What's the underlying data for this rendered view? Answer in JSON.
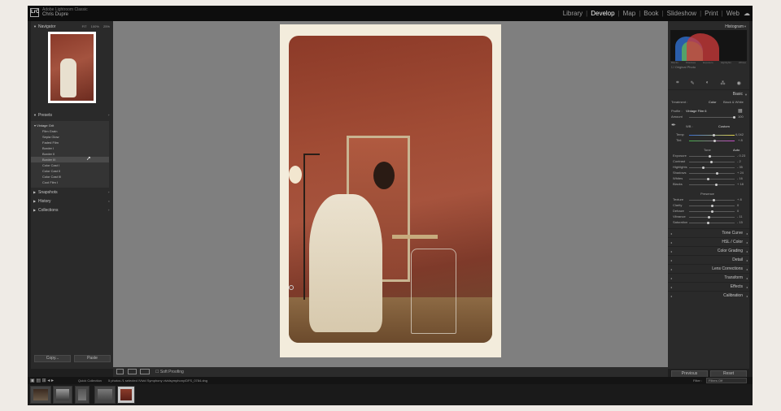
{
  "catalog": {
    "line1": "Adobe Lightroom Classic",
    "user": "Chris Dupre"
  },
  "modules": [
    "Library",
    "Develop",
    "Map",
    "Book",
    "Slideshow",
    "Print",
    "Web"
  ],
  "active_module": "Develop",
  "left_panel": {
    "navigator": {
      "title": "Navigator",
      "options": [
        "FIT",
        "100%",
        "25%"
      ]
    },
    "presets": {
      "title": "Presets",
      "group": "Vintage Grit",
      "items": [
        "Film Grain",
        "Sepia Glow",
        "Faded Film",
        "Border I",
        "Border II",
        "Border III",
        "Color Cast I",
        "Color Cast II",
        "Color Cast III",
        "Cool Film I"
      ]
    },
    "snapshots": "Snapshots",
    "history": "History",
    "collections": "Collections",
    "copy_button": "Copy...",
    "paste_button": "Paste"
  },
  "toolbar": {
    "soft_proofing": "Soft Proofing"
  },
  "right_panel": {
    "histogram_title": "Histogram",
    "histogram_labels": [
      "Blacks",
      "Shadows",
      "Exposure",
      "Highlights",
      "Whites"
    ],
    "original_photo": "Original Photo",
    "basic": {
      "title": "Basic",
      "treatment_label": "Treatment :",
      "treatment_color": "Color",
      "treatment_bw": "Black & White",
      "profile_label": "Profile :",
      "profile_value": "Vintage Film 6",
      "amount_label": "Amount",
      "amount_value": "100",
      "wb_label": "WB :",
      "wb_value": "Custom",
      "temp_label": "Temp",
      "temp_value": "6,042",
      "tint_label": "Tint",
      "tint_value": "+ 8",
      "tone_label": "Tone",
      "tone_auto": "Auto",
      "tone_sliders": [
        {
          "label": "Exposure",
          "value": "- 0.23",
          "pos": 0.46
        },
        {
          "label": "Contrast",
          "value": "- 2",
          "pos": 0.49
        },
        {
          "label": "Highlights",
          "value": "- 35",
          "pos": 0.32
        },
        {
          "label": "Shadows",
          "value": "+ 24",
          "pos": 0.62
        },
        {
          "label": "Whites",
          "value": "- 16",
          "pos": 0.42
        },
        {
          "label": "Blacks",
          "value": "+ 18",
          "pos": 0.59
        }
      ],
      "presence_label": "Presence",
      "presence_sliders": [
        {
          "label": "Texture",
          "value": "+ 8",
          "pos": 0.54
        },
        {
          "label": "Clarity",
          "value": "0",
          "pos": 0.5
        },
        {
          "label": "Dehaze",
          "value": "0",
          "pos": 0.5
        },
        {
          "label": "Vibrance",
          "value": "- 11",
          "pos": 0.44
        },
        {
          "label": "Saturation",
          "value": "- 15",
          "pos": 0.42
        }
      ]
    },
    "sections": [
      "Tone Curve",
      "HSL / Color",
      "Color Grading",
      "Detail",
      "Lens Corrections",
      "Transform",
      "Effects",
      "Calibration"
    ],
    "previous_button": "Previous",
    "reset_button": "Reset"
  },
  "filmstrip": {
    "source": "Quick Collection",
    "info": "5 photos /1 selected /Vivid Symphony vividsymphony/DFS_0784.dng",
    "filter_label": "Filter :",
    "filter_value": "Filters Off"
  }
}
